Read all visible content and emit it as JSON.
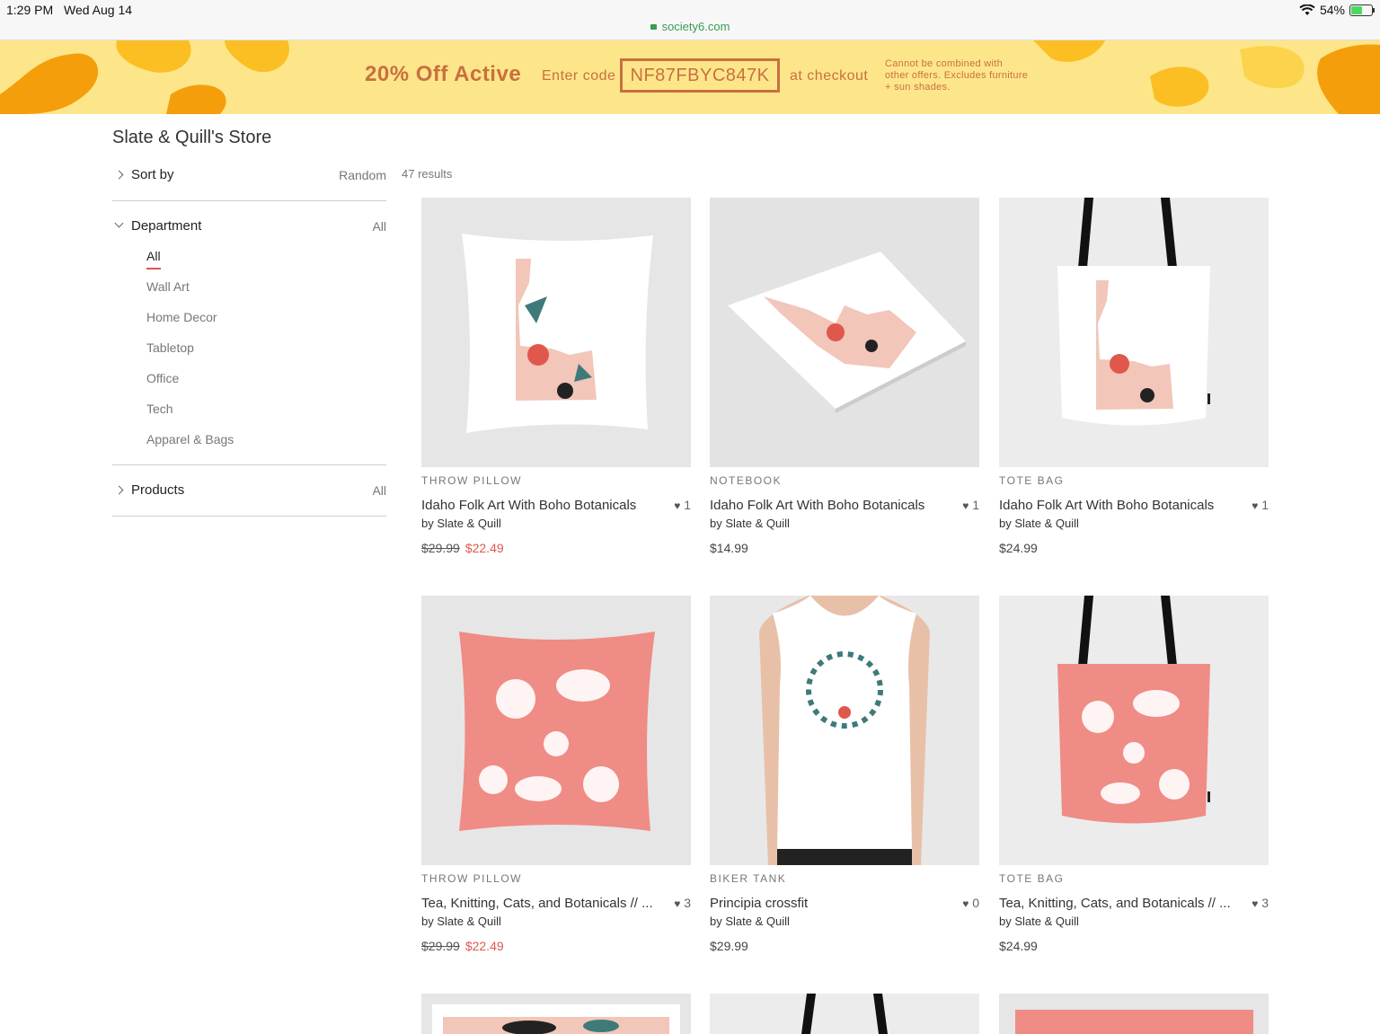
{
  "status_bar": {
    "time": "1:29 PM",
    "date": "Wed Aug 14",
    "url": "society6.com",
    "battery": "54%"
  },
  "promo": {
    "title": "20% Off Active",
    "enter": "Enter code",
    "code": "NF87FBYC847K",
    "at": "at checkout",
    "fine": "Cannot be combined with other offers. Excludes furniture + sun shades."
  },
  "store": {
    "title": "Slate & Quill's Store",
    "results": "47 results"
  },
  "filters": {
    "sort": {
      "label": "Sort by",
      "value": "Random"
    },
    "department": {
      "label": "Department",
      "value": "All",
      "items": [
        "All",
        "Wall Art",
        "Home Decor",
        "Tabletop",
        "Office",
        "Tech",
        "Apparel & Bags"
      ],
      "active": "All"
    },
    "products": {
      "label": "Products",
      "value": "All"
    }
  },
  "products": [
    {
      "type": "THROW PILLOW",
      "title": "Idaho Folk Art With Boho Botanicals",
      "likes": "1",
      "by": "by Slate & Quill",
      "price_old": "$29.99",
      "price_new": "$22.49"
    },
    {
      "type": "NOTEBOOK",
      "title": "Idaho Folk Art With Boho Botanicals",
      "likes": "1",
      "by": "by Slate & Quill",
      "price": "$14.99"
    },
    {
      "type": "TOTE BAG",
      "title": "Idaho Folk Art With Boho Botanicals",
      "likes": "1",
      "by": "by Slate & Quill",
      "price": "$24.99"
    },
    {
      "type": "THROW PILLOW",
      "title": "Tea, Knitting, Cats, and Botanicals // ...",
      "likes": "3",
      "by": "by Slate & Quill",
      "price_old": "$29.99",
      "price_new": "$22.49"
    },
    {
      "type": "BIKER TANK",
      "title": "Principia crossfit",
      "likes": "0",
      "by": "by Slate & Quill",
      "price": "$29.99"
    },
    {
      "type": "TOTE BAG",
      "title": "Tea, Knitting, Cats, and Botanicals // ...",
      "likes": "3",
      "by": "by Slate & Quill",
      "price": "$24.99"
    }
  ],
  "colors": {
    "accent": "#e0584c",
    "promo_bg": "#fde68a",
    "promo_text": "#c8703f",
    "pink": "#ef8c85"
  }
}
